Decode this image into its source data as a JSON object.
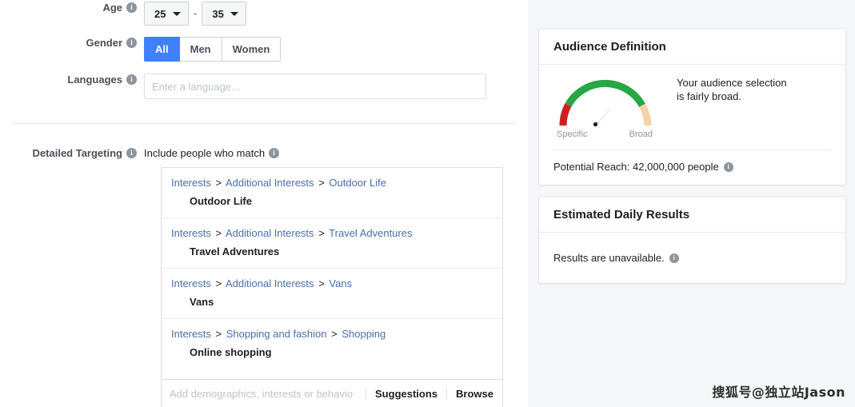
{
  "form": {
    "age": {
      "label": "Age",
      "info_icon": "info-icon",
      "min": "25",
      "max": "35",
      "dash": "-"
    },
    "gender": {
      "label": "Gender",
      "options": [
        {
          "label": "All",
          "selected": true
        },
        {
          "label": "Men",
          "selected": false
        },
        {
          "label": "Women",
          "selected": false
        }
      ]
    },
    "languages": {
      "label": "Languages",
      "value": "",
      "placeholder": "Enter a language..."
    },
    "detailed_targeting": {
      "label": "Detailed Targeting",
      "include_label": "Include people who match",
      "items": [
        {
          "crumbs": [
            "Interests",
            "Additional Interests",
            "Outdoor Life"
          ],
          "name": "Outdoor Life"
        },
        {
          "crumbs": [
            "Interests",
            "Additional Interests",
            "Travel Adventures"
          ],
          "name": "Travel Adventures"
        },
        {
          "crumbs": [
            "Interests",
            "Additional Interests",
            "Vans"
          ],
          "name": "Vans"
        },
        {
          "crumbs": [
            "Interests",
            "Shopping and fashion",
            "Shopping"
          ],
          "name": "Online shopping"
        }
      ],
      "search_placeholder": "Add demographics, interests or behavio",
      "search_value": "",
      "suggestions_label": "Suggestions",
      "browse_label": "Browse",
      "separator": ">"
    }
  },
  "right_panel": {
    "audience": {
      "title": "Audience Definition",
      "gauge": {
        "left_label": "Specific",
        "right_label": "Broad",
        "needle_value": 0.56,
        "colors": {
          "specific": "#d32f2f",
          "mid": "#27a745",
          "broad": "#f2d0a4"
        }
      },
      "description": "Your audience selection is fairly broad.",
      "reach_label": "Potential Reach:",
      "reach_value": "42,000,000 people"
    },
    "results": {
      "title": "Estimated Daily Results",
      "message": "Results are unavailable."
    }
  },
  "watermark": {
    "text": "搜狐号@独立站Jason"
  },
  "icons": {
    "info": "i"
  }
}
